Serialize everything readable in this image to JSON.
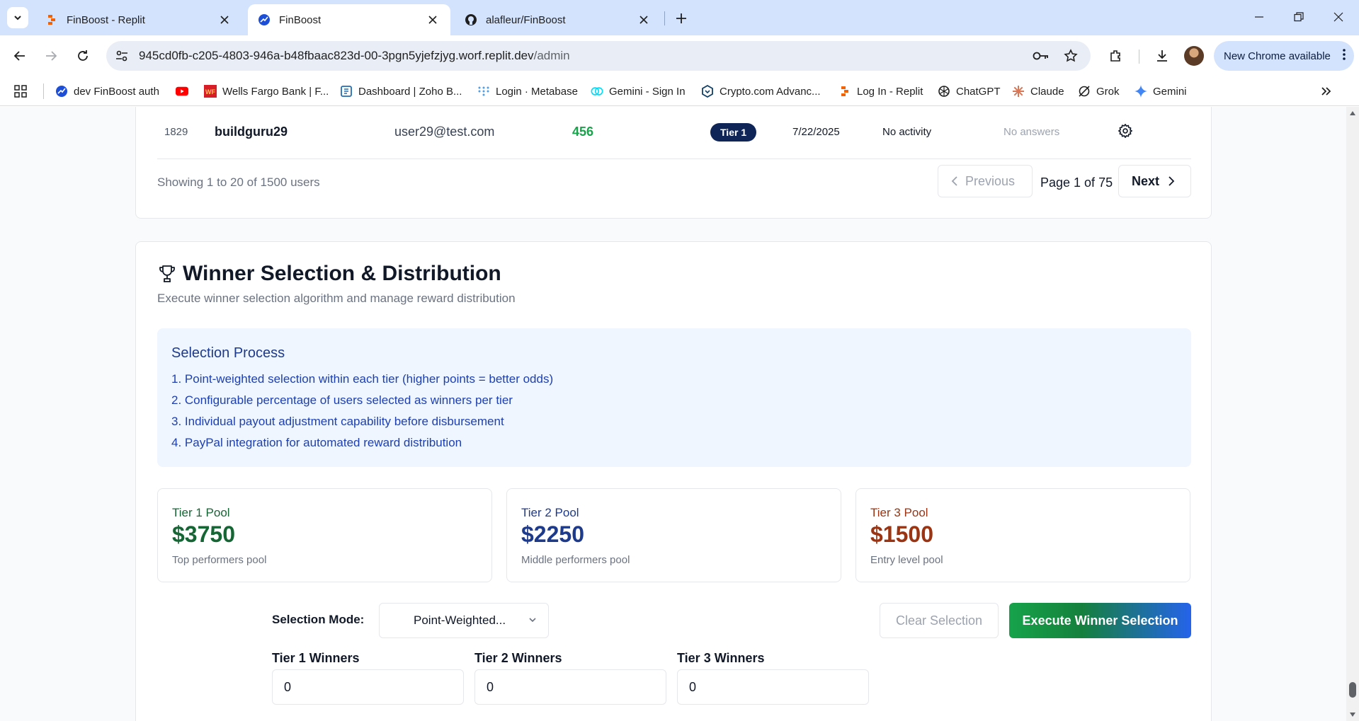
{
  "browser": {
    "tabs": [
      {
        "title": "FinBoost - Replit"
      },
      {
        "title": "FinBoost"
      },
      {
        "title": "alafleur/FinBoost"
      }
    ],
    "url_host": "945cd0fb-c205-4803-946a-b48fbaac823d-00-3pgn5yjefzjyg.worf.replit.dev",
    "url_path": "/admin",
    "update_label": "New Chrome available",
    "bookmarks": [
      {
        "label": "dev FinBoost auth"
      },
      {
        "label": ""
      },
      {
        "label": "Wells Fargo Bank | F..."
      },
      {
        "label": "Dashboard | Zoho B..."
      },
      {
        "label": "Login · Metabase"
      },
      {
        "label": "Gemini - Sign In"
      },
      {
        "label": "Crypto.com Advanc..."
      },
      {
        "label": "Log In - Replit"
      },
      {
        "label": "ChatGPT"
      },
      {
        "label": "Claude"
      },
      {
        "label": "Grok"
      },
      {
        "label": "Gemini"
      }
    ]
  },
  "users_table": {
    "row": {
      "id": "1829",
      "username": "buildguru29",
      "email": "user29@test.com",
      "points": "456",
      "tier": "Tier 1",
      "date": "7/22/2025",
      "activity": "No activity",
      "answers": "No answers"
    },
    "showing_text": "Showing 1 to 20 of 1500 users",
    "pagination": {
      "previous_label": "Previous",
      "page_label": "Page 1 of 75",
      "next_label": "Next"
    }
  },
  "winner_section": {
    "title": "Winner Selection & Distribution",
    "subtitle": "Execute winner selection algorithm and manage reward distribution",
    "process": {
      "heading": "Selection Process",
      "steps": [
        "1. Point-weighted selection within each tier (higher points = better odds)",
        "2. Configurable percentage of users selected as winners per tier",
        "3. Individual payout adjustment capability before disbursement",
        "4. PayPal integration for automated reward distribution"
      ]
    },
    "pools": [
      {
        "name": "Tier 1 Pool",
        "amount": "$3750",
        "description": "Top performers pool",
        "color": "#166534"
      },
      {
        "name": "Tier 2 Pool",
        "amount": "$2250",
        "description": "Middle performers pool",
        "color": "#1e3a8a"
      },
      {
        "name": "Tier 3 Pool",
        "amount": "$1500",
        "description": "Entry level pool",
        "color": "#9a3412"
      }
    ],
    "selection_mode_label": "Selection Mode:",
    "selection_mode_value": "Point-Weighted...",
    "clear_label": "Clear Selection",
    "execute_label": "Execute Winner Selection",
    "tier_winners": [
      {
        "label": "Tier 1 Winners",
        "value": "0"
      },
      {
        "label": "Tier 2 Winners",
        "value": "0"
      },
      {
        "label": "Tier 3 Winners",
        "value": "0"
      }
    ]
  },
  "colors": {
    "accent_green": "#16a34a",
    "tier_badge": "#0f2557",
    "process_bg": "#eff6ff"
  }
}
